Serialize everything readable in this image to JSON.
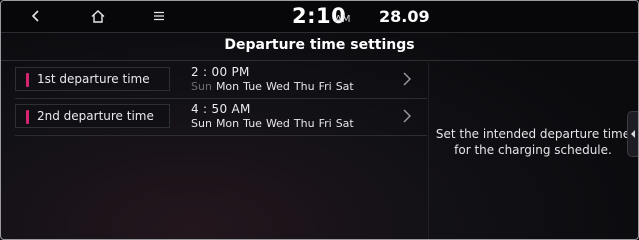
{
  "status_bar": {
    "back_icon": "back-arrow-icon",
    "home_icon": "home-icon",
    "menu_icon": "menu-icon",
    "time": "2:10",
    "ampm": "AM",
    "temperature": "28.09"
  },
  "page": {
    "title": "Departure time settings"
  },
  "departures": [
    {
      "label": "1st departure time",
      "time": "2 : 00 PM",
      "days": [
        {
          "name": "Sun",
          "active": false
        },
        {
          "name": "Mon",
          "active": true
        },
        {
          "name": "Tue",
          "active": true
        },
        {
          "name": "Wed",
          "active": true
        },
        {
          "name": "Thu",
          "active": true
        },
        {
          "name": "Fri",
          "active": true
        },
        {
          "name": "Sat",
          "active": true
        }
      ]
    },
    {
      "label": "2nd departure time",
      "time": "4 : 50 AM",
      "days": [
        {
          "name": "Sun",
          "active": true
        },
        {
          "name": "Mon",
          "active": true
        },
        {
          "name": "Tue",
          "active": true
        },
        {
          "name": "Wed",
          "active": true
        },
        {
          "name": "Thu",
          "active": true
        },
        {
          "name": "Fri",
          "active": true
        },
        {
          "name": "Sat",
          "active": true
        }
      ]
    }
  ],
  "info": {
    "text": "Set the intended departure time for the charging schedule."
  },
  "colors": {
    "accent": "#d62472",
    "active_day": "#e6e6ea",
    "inactive_day": "#6b6b72"
  }
}
